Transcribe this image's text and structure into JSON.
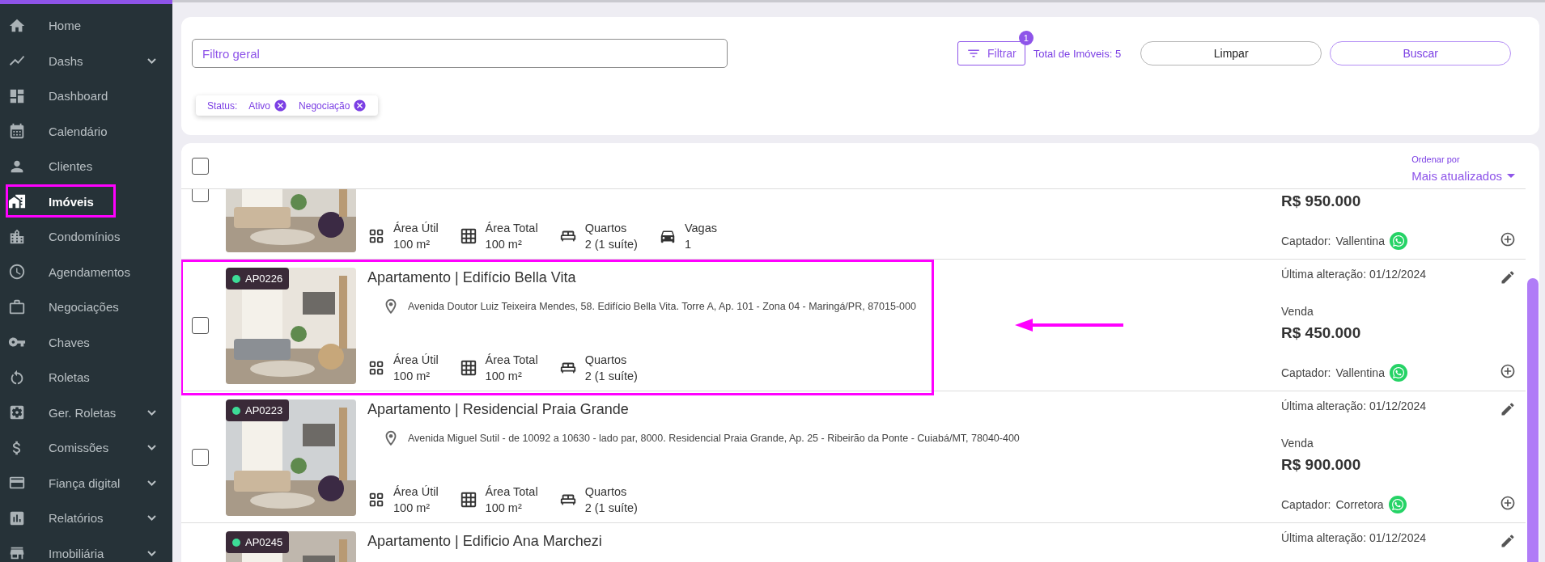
{
  "sidebar": {
    "items": [
      {
        "label": "Home",
        "selected": false,
        "has_submenu": false,
        "highlighted": false
      },
      {
        "label": "Dashs",
        "selected": false,
        "has_submenu": true,
        "highlighted": false
      },
      {
        "label": "Dashboard",
        "selected": false,
        "has_submenu": false,
        "highlighted": false
      },
      {
        "label": "Calendário",
        "selected": false,
        "has_submenu": false,
        "highlighted": false
      },
      {
        "label": "Clientes",
        "selected": false,
        "has_submenu": false,
        "highlighted": false
      },
      {
        "label": "Imóveis",
        "selected": true,
        "has_submenu": false,
        "highlighted": true
      },
      {
        "label": "Condomínios",
        "selected": false,
        "has_submenu": false,
        "highlighted": false
      },
      {
        "label": "Agendamentos",
        "selected": false,
        "has_submenu": false,
        "highlighted": false
      },
      {
        "label": "Negociações",
        "selected": false,
        "has_submenu": false,
        "highlighted": false
      },
      {
        "label": "Chaves",
        "selected": false,
        "has_submenu": false,
        "highlighted": false
      },
      {
        "label": "Roletas",
        "selected": false,
        "has_submenu": false,
        "highlighted": false
      },
      {
        "label": "Ger. Roletas",
        "selected": false,
        "has_submenu": true,
        "highlighted": false
      },
      {
        "label": "Comissões",
        "selected": false,
        "has_submenu": true,
        "highlighted": false
      },
      {
        "label": "Fiança digital",
        "selected": false,
        "has_submenu": true,
        "highlighted": false
      },
      {
        "label": "Relatórios",
        "selected": false,
        "has_submenu": true,
        "highlighted": false
      },
      {
        "label": "Imobiliária",
        "selected": false,
        "has_submenu": true,
        "highlighted": false
      }
    ]
  },
  "filters": {
    "search": {
      "placeholder": "Filtro geral"
    },
    "filter_button": "Filtrar",
    "filter_badge": "1",
    "total": "Total de Imóveis: 5",
    "clear_button": "Limpar",
    "search_button": "Buscar",
    "chips": {
      "label": "Status:",
      "values": [
        "Ativo",
        "Negociação"
      ]
    }
  },
  "list": {
    "select_all": {
      "checked": false
    },
    "sort_label": "Ordenar por",
    "sort_value": "Mais atualizados",
    "rows": [
      {
        "checked": false,
        "highlighted": false,
        "features": [
          {
            "kind": "area_util",
            "label": "Área Útil",
            "value": "100 m²"
          },
          {
            "kind": "area_total",
            "label": "Área Total",
            "value": "100 m²"
          },
          {
            "kind": "rooms",
            "label": "Quartos",
            "value": "2 (1 suíte)"
          },
          {
            "kind": "parking",
            "label": "Vagas",
            "value": "1"
          }
        ],
        "price": "R$ 950.000",
        "captador_label": "Captador:",
        "captador": "Vallentina"
      },
      {
        "checked": false,
        "highlighted": true,
        "code": "AP0226",
        "color": "#3ddc97",
        "title": "Apartamento | Edifício Bella Vita",
        "address": "Avenida Doutor Luiz Teixeira Mendes, 58. Edifício Bella Vita. Torre A, Ap. 101 - Zona 04 - Maringá/PR, 87015-000",
        "features": [
          {
            "kind": "area_util",
            "label": "Área Útil",
            "value": "100 m²"
          },
          {
            "kind": "area_total",
            "label": "Área Total",
            "value": "100 m²"
          },
          {
            "kind": "rooms",
            "label": "Quartos",
            "value": "2 (1 suíte)"
          }
        ],
        "updated": "Última alteração: 01/12/2024",
        "deal": "Venda",
        "price": "R$ 450.000",
        "captador_label": "Captador:",
        "captador": "Vallentina"
      },
      {
        "checked": false,
        "highlighted": false,
        "code": "AP0223",
        "color": "#3ddc97",
        "title": "Apartamento | Residencial Praia Grande",
        "address": "Avenida Miguel Sutil - de 10092 a 10630 - lado par, 8000. Residencial Praia Grande, Ap. 25 - Ribeirão da Ponte - Cuiabá/MT, 78040-400",
        "features": [
          {
            "kind": "area_util",
            "label": "Área Útil",
            "value": "100 m²"
          },
          {
            "kind": "area_total",
            "label": "Área Total",
            "value": "100 m²"
          },
          {
            "kind": "rooms",
            "label": "Quartos",
            "value": "2 (1 suíte)"
          }
        ],
        "updated": "Última alteração: 01/12/2024",
        "deal": "Venda",
        "price": "R$ 900.000",
        "captador_label": "Captador:",
        "captador": "Corretora"
      },
      {
        "highlighted": false,
        "code": "AP0245",
        "color": "#3ddc97",
        "title": "Apartamento | Edificio Ana Marchezi",
        "updated": "Última alteração: 01/12/2024"
      }
    ]
  }
}
